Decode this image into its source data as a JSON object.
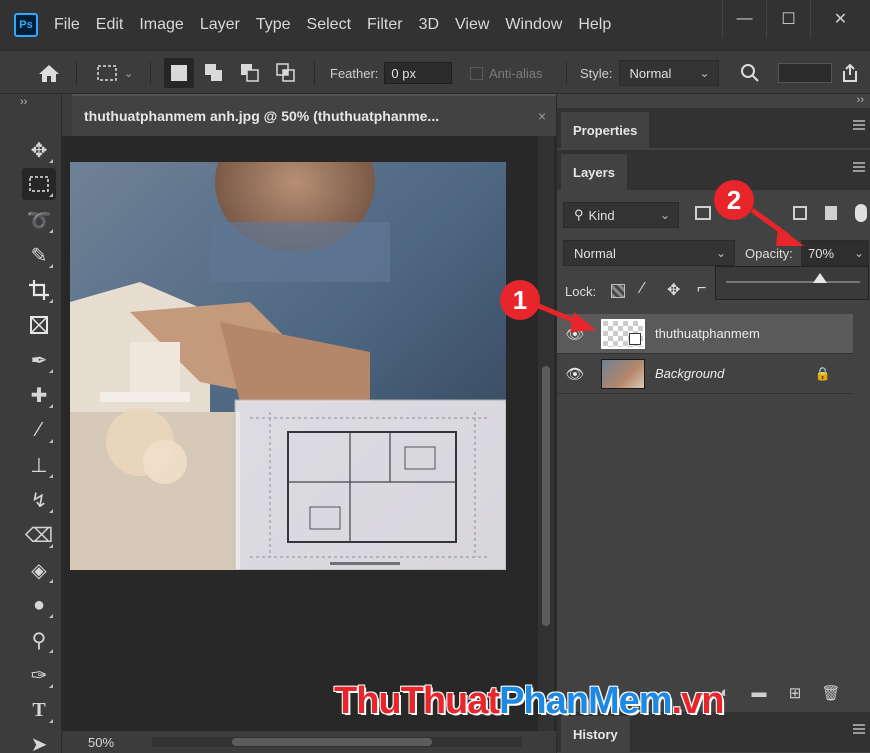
{
  "app": {
    "logo": "Ps"
  },
  "menu": [
    "File",
    "Edit",
    "Image",
    "Layer",
    "Type",
    "Select",
    "Filter",
    "3D",
    "View",
    "Window",
    "Help"
  ],
  "window_controls": {
    "minimize": "—",
    "maximize": "☐",
    "close": "✕"
  },
  "options_bar": {
    "feather_label": "Feather:",
    "feather_value": "0 px",
    "antialias_label": "Anti-alias",
    "style_label": "Style:",
    "style_value": "Normal"
  },
  "document": {
    "tab_title": "thuthuatphanmem anh.jpg @ 50% (thuthuatphanme...",
    "tab_close": "×",
    "zoom": "50%",
    "collapse_left": "››"
  },
  "panels": {
    "properties_title": "Properties",
    "layers_title": "Layers",
    "history_title": "History",
    "collapse_right": "››",
    "filter_label": "Kind",
    "blend_mode": "Normal",
    "opacity_label": "Opacity:",
    "opacity_value": "70%",
    "lock_label": "Lock:",
    "opacity_slider_fraction": 0.7
  },
  "layers": [
    {
      "name": "thuthuatphanmem",
      "selected": true,
      "italic": false
    },
    {
      "name": "Background",
      "selected": false,
      "italic": true
    }
  ],
  "callouts": {
    "one": "1",
    "two": "2"
  },
  "watermark": {
    "part1": "ThuThuat",
    "part2": "PhanMem",
    "part3": ".vn"
  },
  "colors": {
    "accent_red": "#e8252b",
    "ps_blue": "#31a8ff"
  }
}
